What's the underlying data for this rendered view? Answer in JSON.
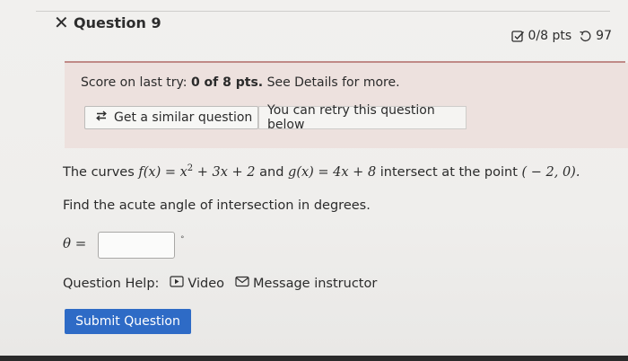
{
  "header": {
    "close_symbol": "✕",
    "question_title": "Question 9",
    "points": "0/8 pts",
    "retries": "97"
  },
  "score": {
    "prefix": "Score on last try: ",
    "value": "0 of 8 pts.",
    "suffix": " See Details for more."
  },
  "actions": {
    "similar_label": "Get a similar question",
    "retry_text": "You can retry this question below"
  },
  "problem": {
    "intro": "The curves ",
    "f_expr": "f(x) = x",
    "f_exp": "2",
    "f_rest": " + 3x + 2",
    "and": " and ",
    "g_expr": "g(x) = 4x + 8",
    "intersect": " intersect at the point ",
    "point": "( − 2, 0).",
    "find": "Find the acute angle of intersection in degrees."
  },
  "answer": {
    "label": "θ =",
    "value": "",
    "unit": "°"
  },
  "help": {
    "label": "Question Help:",
    "video": "Video",
    "message": "Message instructor"
  },
  "submit_label": "Submit Question",
  "colors": {
    "accent": "#2e6bc6",
    "score_panel": "#ede1de",
    "divider": "#c08a87"
  }
}
